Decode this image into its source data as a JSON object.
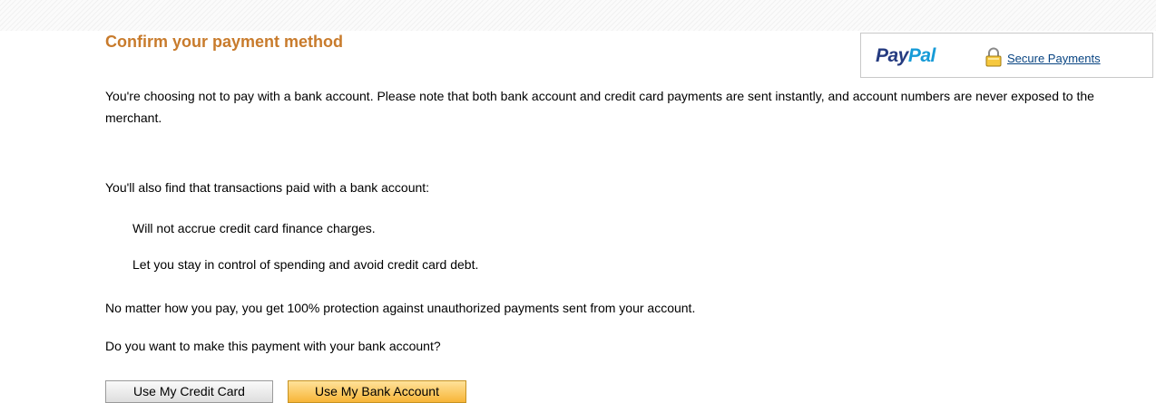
{
  "header": {
    "title": "Confirm your payment method"
  },
  "brand": {
    "logo_text_dark": "Pay",
    "logo_text_light": "Pal",
    "secure_link": "Secure Payments",
    "lock_icon": "lock-icon"
  },
  "content": {
    "intro": "You're choosing not to pay with a bank account. Please note that both bank account and credit card payments are sent instantly, and account numbers are never exposed to the merchant.",
    "benefits_heading": "You'll also find that transactions paid with a bank account:",
    "benefits": [
      "Will not accrue credit card finance charges.",
      "Let you stay in control of spending and avoid credit card debt."
    ],
    "protection": "No matter how you pay, you get 100% protection against unauthorized payments sent from your account.",
    "question": "Do you want to make this payment with your bank account?"
  },
  "actions": {
    "credit_card_label": "Use My Credit Card",
    "bank_account_label": "Use My Bank Account"
  },
  "colors": {
    "title": "#c87b2c",
    "link": "#084482",
    "paypal_dark": "#253b80",
    "paypal_light": "#179bd7",
    "primary_button": "#f7b538"
  }
}
